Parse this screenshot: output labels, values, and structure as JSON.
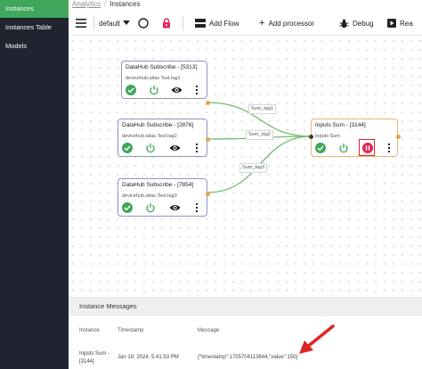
{
  "sidebar": {
    "items": [
      {
        "label": "Instances",
        "active": true
      },
      {
        "label": "Instances Table",
        "active": false
      },
      {
        "label": "Models",
        "active": false
      }
    ]
  },
  "breadcrumb": {
    "parent": "Analytics",
    "current": "Instances"
  },
  "toolbar": {
    "env_value": "default",
    "add_flow_label": "Add Flow",
    "add_processor_label": "Add processor",
    "debug_label": "Debug",
    "read_label": "Rea"
  },
  "nodes": {
    "n1": {
      "title": "DataHub Subscribe - [5313]",
      "sub": "devicehub.alias.Test.tag1"
    },
    "n2": {
      "title": "DataHub Subscribe - [2876]",
      "sub": "devicehub.alias.Test.tag2"
    },
    "n3": {
      "title": "DataHub Subscribe - [7854]",
      "sub": "devicehub.alias.Test.tag3"
    },
    "sum": {
      "title": "Inputs Sum - [3144]",
      "sub": "Inputs Sum"
    }
  },
  "edge_labels": {
    "e1": "Sum_tag1",
    "e2": "Sum_tag2",
    "e3": "Sum_tag3"
  },
  "messages": {
    "title": "Instance Messages",
    "columns": {
      "instance": "Instance",
      "timestamp": "Timestamp",
      "message": "Message"
    },
    "row": {
      "instance_line1": "Inputs Sum -",
      "instance_line2": "[3144]",
      "timestamp": "Jan 19, 2024, 5:41:53 PM",
      "message": "{\"timestamp\":1705704113844,\"value\":150}"
    }
  },
  "colors": {
    "accent": "#3fa65c",
    "sidebar": "#1f2430",
    "highlight": "#e02424",
    "node_border": "#8d94c9",
    "sum_border": "#f1b36b"
  }
}
